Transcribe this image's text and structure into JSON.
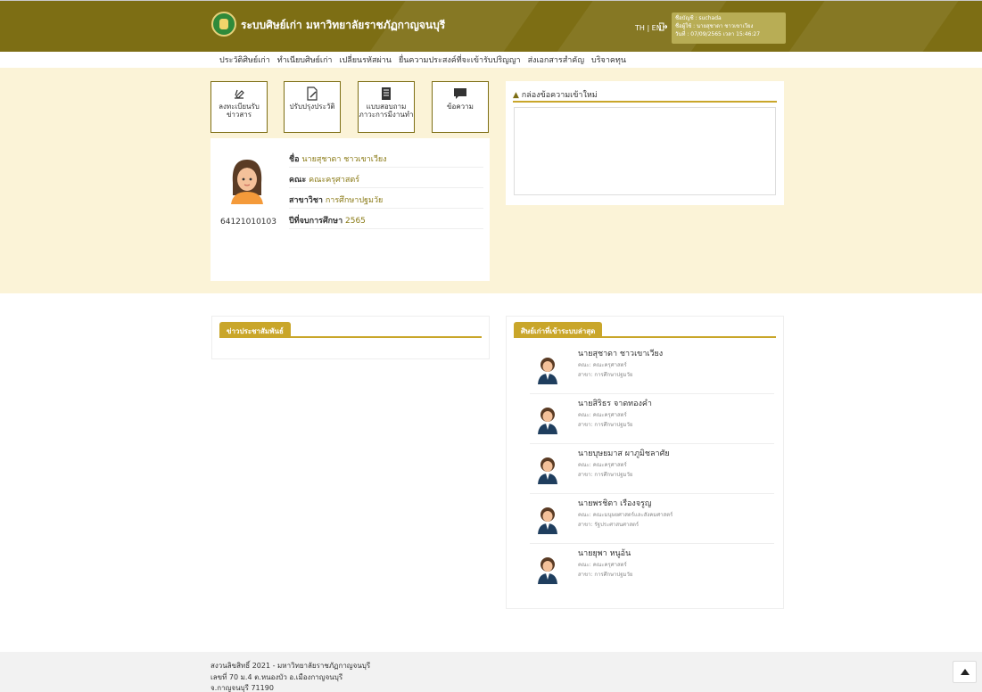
{
  "header": {
    "title": "ระบบศิษย์เก่า มหาวิทยาลัยราชภัฏกาญจนบุรี",
    "lang": "TH | EN",
    "user_line1": "ชื่อบัญชี : suchada",
    "user_line2": "ชื่อผู้ใช้ : นายสุชาดา ชาวเขาเวียง",
    "user_line3": "วันที่ : 07/09/2565 เวลา 15:46:27"
  },
  "nav": {
    "items": [
      "ประวัติศิษย์เก่า",
      "ทำเนียบศิษย์เก่า",
      "เปลี่ยนรหัสผ่าน",
      "ยื่นความประสงค์ที่จะเข้ารับปริญญา",
      "ส่งเอกสารสำคัญ",
      "บริจาคทุน"
    ]
  },
  "tiles": [
    {
      "label": "ลงทะเบียนรับข่าวสาร",
      "icon": "register-news-icon"
    },
    {
      "label": "ปรับปรุงประวัติ",
      "icon": "edit-profile-icon"
    },
    {
      "label": "แบบสอบถามภาวะการมีงานทำ",
      "icon": "survey-icon"
    },
    {
      "label": "ข้อความ",
      "icon": "message-icon"
    }
  ],
  "profile": {
    "student_id": "64121010103",
    "name_label": "ชื่อ",
    "name": "นายสุชาดา ชาวเขาเวียง",
    "faculty_label": "คณะ",
    "faculty": "คณะครุศาสตร์",
    "major_label": "สาขาวิชา",
    "major": "การศึกษาปฐมวัย",
    "grad_year_label": "ปีที่จบการศึกษา",
    "grad_year": "2565"
  },
  "inbox": {
    "title": "กล่องข้อความเข้าใหม่"
  },
  "news": {
    "title": "ข่าวประชาสัมพันธ์"
  },
  "recent": {
    "title": "ศิษย์เก่าที่เข้าระบบล่าสุด",
    "items": [
      {
        "name": "นายสุชาดา ชาวเขาเวียง",
        "faculty": "คณะ: คณะครุศาสตร์",
        "major": "สาขา: การศึกษาปฐมวัย"
      },
      {
        "name": "นายสิริธร จาดทองคำ",
        "faculty": "คณะ: คณะครุศาสตร์",
        "major": "สาขา: การศึกษาปฐมวัย"
      },
      {
        "name": "นายบุษยมาส ผาภูมิชลาศัย",
        "faculty": "คณะ: คณะครุศาสตร์",
        "major": "สาขา: การศึกษาปฐมวัย"
      },
      {
        "name": "นายพรชิตา เรืองจรูญ",
        "faculty": "คณะ: คณะมนุษยศาสตร์และสังคมศาสตร์",
        "major": "สาขา: รัฐประศาสนศาสตร์"
      },
      {
        "name": "นายยุพา หนูอ้น",
        "faculty": "คณะ: คณะครุศาสตร์",
        "major": "สาขา: การศึกษาปฐมวัย"
      }
    ]
  },
  "footer": {
    "line1": "สงวนลิขสิทธิ์ 2021 - มหาวิทยาลัยราชภัฏกาญจนบุรี",
    "line2": "เลขที่ 70 ม.4 ต.หนองบัว อ.เมืองกาญจนบุรี",
    "line3": "จ.กาญจนบุรี 71190"
  },
  "colors": {
    "brand": "#7d6e14",
    "accent": "#c9a62a",
    "band": "#fbf3d7"
  }
}
